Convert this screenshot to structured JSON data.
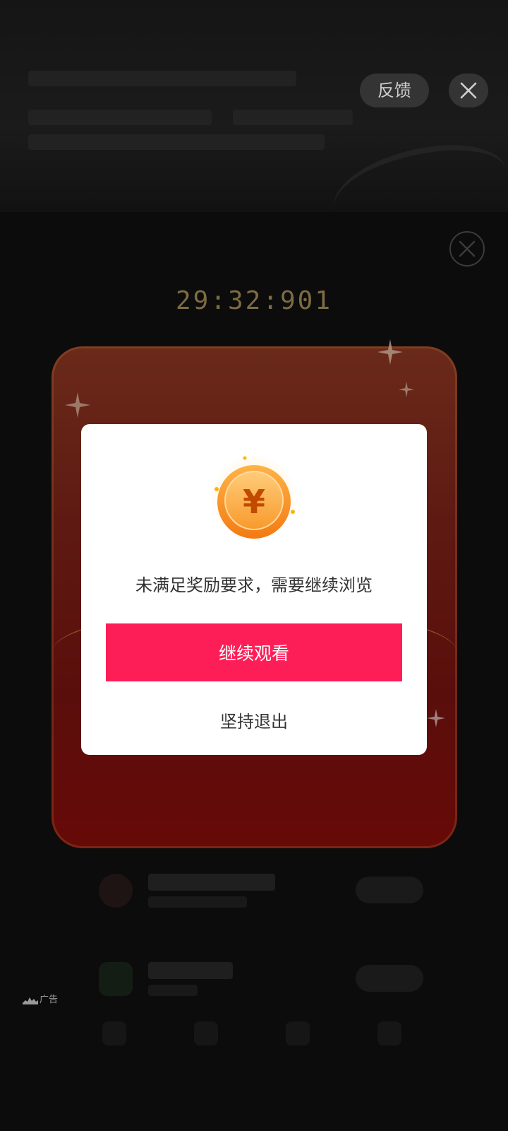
{
  "topbar": {
    "feedback_label": "反馈",
    "close_icon": "close-icon"
  },
  "countdown": {
    "value": "29:32:901",
    "color": "#7e6c42"
  },
  "envelope": {
    "color": "#5e1a12"
  },
  "dialog": {
    "coin_symbol": "¥",
    "message": "未满足奖励要求，需要继续浏览",
    "primary_label": "继续观看",
    "secondary_label": "坚持退出",
    "primary_color": "#fe1e57"
  },
  "ad": {
    "label": "广告",
    "icon": "ad-logo-icon"
  }
}
